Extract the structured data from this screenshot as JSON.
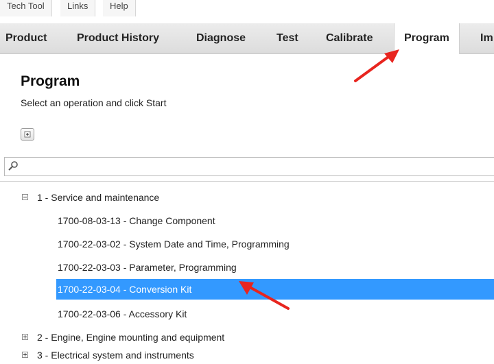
{
  "top_menu": {
    "items": [
      "Tech Tool",
      "Links",
      "Help"
    ]
  },
  "nav": {
    "tabs": [
      {
        "label": "Product"
      },
      {
        "label": "Product History"
      },
      {
        "label": "Diagnose"
      },
      {
        "label": "Test"
      },
      {
        "label": "Calibrate"
      },
      {
        "label": "Program"
      },
      {
        "label": "Im"
      }
    ],
    "active_tab": "Program"
  },
  "page": {
    "title": "Program",
    "subtitle": "Select an operation and click Start",
    "expand_icon": "plus-icon"
  },
  "search": {
    "value": "",
    "icon": "search-icon"
  },
  "tree": {
    "groups": [
      {
        "label": "1 - Service and maintenance",
        "expanded": true,
        "children": [
          {
            "label": "1700-08-03-13 - Change Component"
          },
          {
            "label": "1700-22-03-02 - System Date and Time, Programming"
          },
          {
            "label": "1700-22-03-03 - Parameter, Programming"
          },
          {
            "label": "1700-22-03-04 - Conversion Kit",
            "selected": true
          },
          {
            "label": "1700-22-03-06 - Accessory Kit"
          }
        ]
      },
      {
        "label": "2 - Engine, Engine mounting and equipment",
        "expanded": false
      },
      {
        "label": "3 - Electrical system and instruments",
        "expanded": false
      }
    ]
  },
  "colors": {
    "selection": "#3399ff",
    "arrow": "#e8251f",
    "navbar": "#e2e2e2"
  }
}
